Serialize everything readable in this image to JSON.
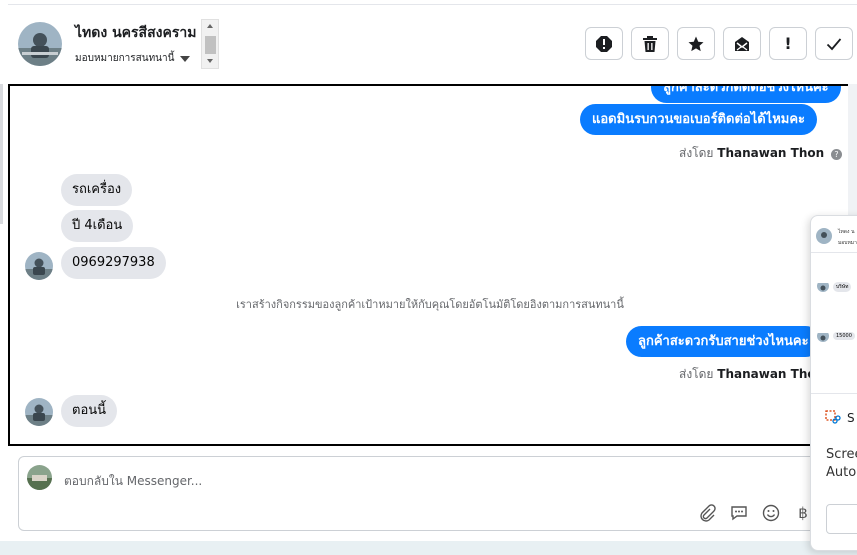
{
  "header": {
    "contact_name": "ไทดง นครสีสงคราม",
    "assign_label": "มอบหมายการสนทนานี้"
  },
  "actions": [
    {
      "name": "spam-icon",
      "glyph": "!"
    },
    {
      "name": "trash-icon",
      "glyph": "🗑"
    },
    {
      "name": "star-icon",
      "glyph": "★"
    },
    {
      "name": "mark-unread-icon",
      "glyph": "✉"
    },
    {
      "name": "follow-up-icon",
      "glyph": "!"
    },
    {
      "name": "done-icon",
      "glyph": "✓"
    }
  ],
  "messages": {
    "out_partial": "ลูกค้าสะดวกติดต่อช่วงไหนคะ",
    "out_1": "แอดมินรบกวนขอเบอร์ติดต่อได้ไหมคะ",
    "sent_by_prefix": "ส่งโดย",
    "sent_by_name": "Thanawan Thon",
    "in_1": "รถเครื่อง",
    "in_2": "ปี 4เดือน",
    "in_3": "0969297938",
    "system_note": "เราสร้างกิจกรรมของลูกค้าเป้าหมายให้กับคุณโดยอัตโนมัติโดยอิงตามการสนทนานี้",
    "out_2": "ลูกค้าสะดวกรับสายช่วงไหนคะ",
    "in_4": "ตอนนี้"
  },
  "reply": {
    "placeholder": "ตอบกลับใน Messenger..."
  },
  "popup": {
    "mini_name": "ไทดง น",
    "mini_assign": "มอบหมา",
    "mini_msg_1": "บริษัท",
    "mini_msg_2": "15000",
    "snip_label": "S",
    "snip_line_1": "Scree",
    "snip_line_2": "Auto"
  },
  "colors": {
    "accent": "#0a7cff",
    "incoming_bubble": "#e4e6eb"
  }
}
